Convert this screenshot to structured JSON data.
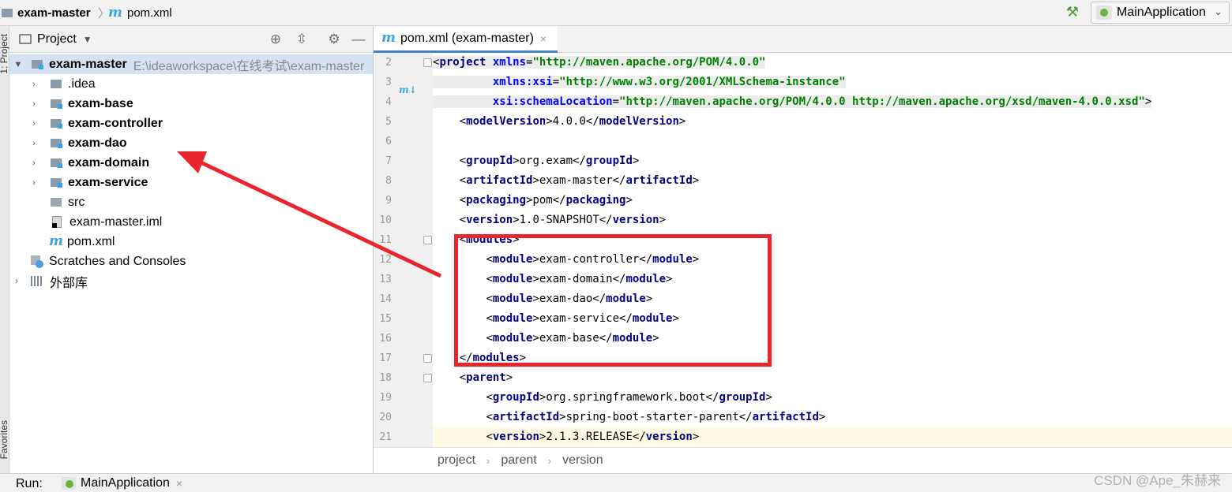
{
  "nav": {
    "project": "exam-master",
    "separator": "〉",
    "file": "pom.xml",
    "run_config": "MainApplication"
  },
  "left_strip": {
    "top_label": "1: Project",
    "bottom_label": "Favorites"
  },
  "project_panel": {
    "title": "Project",
    "root": {
      "name": "exam-master",
      "path": "E:\\ideaworkspace\\在线考试\\exam-master"
    },
    "children": [
      {
        "name": ".idea",
        "bold": false,
        "expandable": true
      },
      {
        "name": "exam-base",
        "bold": true,
        "expandable": true
      },
      {
        "name": "exam-controller",
        "bold": true,
        "expandable": true
      },
      {
        "name": "exam-dao",
        "bold": true,
        "expandable": true
      },
      {
        "name": "exam-domain",
        "bold": true,
        "expandable": true
      },
      {
        "name": "exam-service",
        "bold": true,
        "expandable": true
      },
      {
        "name": "src",
        "bold": false,
        "expandable": false
      },
      {
        "name": "exam-master.iml",
        "bold": false,
        "expandable": false
      },
      {
        "name": "pom.xml",
        "bold": false,
        "expandable": false
      }
    ],
    "scratches": "Scratches and Consoles",
    "external": "外部库"
  },
  "editor": {
    "tab": "pom.xml (exam-master)",
    "lines": [
      {
        "n": "2",
        "html": "<span class='p'>&lt;</span><span class='t'>project </span><span class='a'>xmlns</span><span class='p'>=</span><span class='s'>\"http://maven.apache.org/POM/4.0.0\"</span>",
        "hl": true
      },
      {
        "n": "3",
        "html": "         <span class='a'>xmlns:xsi</span><span class='p'>=</span><span class='s'>\"http://www.w3.org/2001/XMLSchema-instance\"</span>",
        "hl": true
      },
      {
        "n": "4",
        "html": "         <span class='a'>xsi:schemaLocation</span><span class='p'>=</span><span class='s'>\"http://maven.apache.org/POM/4.0.0 http://maven.apache.org/xsd/maven-4.0.0.xsd\"</span><span class='p'>&gt;</span>",
        "hl": true
      },
      {
        "n": "5",
        "html": "    <span class='p'>&lt;</span><span class='t'>modelVersion</span><span class='p'>&gt;4.0.0&lt;/</span><span class='t'>modelVersion</span><span class='p'>&gt;</span>"
      },
      {
        "n": "6",
        "html": ""
      },
      {
        "n": "7",
        "html": "    <span class='p'>&lt;</span><span class='t'>groupId</span><span class='p'>&gt;org.exam&lt;/</span><span class='t'>groupId</span><span class='p'>&gt;</span>"
      },
      {
        "n": "8",
        "html": "    <span class='p'>&lt;</span><span class='t'>artifactId</span><span class='p'>&gt;exam-master&lt;/</span><span class='t'>artifactId</span><span class='p'>&gt;</span>"
      },
      {
        "n": "9",
        "html": "    <span class='p'>&lt;</span><span class='t'>packaging</span><span class='p'>&gt;pom&lt;/</span><span class='t'>packaging</span><span class='p'>&gt;</span>"
      },
      {
        "n": "10",
        "html": "    <span class='p'>&lt;</span><span class='t'>version</span><span class='p'>&gt;1.0-SNAPSHOT&lt;/</span><span class='t'>version</span><span class='p'>&gt;</span>"
      },
      {
        "n": "11",
        "html": "    <span class='p'>&lt;</span><span class='t'>modules</span><span class='p'>&gt;</span>"
      },
      {
        "n": "12",
        "html": "        <span class='p'>&lt;</span><span class='t'>module</span><span class='p'>&gt;exam-controller&lt;/</span><span class='t'>module</span><span class='p'>&gt;</span>"
      },
      {
        "n": "13",
        "html": "        <span class='p'>&lt;</span><span class='t'>module</span><span class='p'>&gt;exam-domain&lt;/</span><span class='t'>module</span><span class='p'>&gt;</span>"
      },
      {
        "n": "14",
        "html": "        <span class='p'>&lt;</span><span class='t'>module</span><span class='p'>&gt;exam-dao&lt;/</span><span class='t'>module</span><span class='p'>&gt;</span>"
      },
      {
        "n": "15",
        "html": "        <span class='p'>&lt;</span><span class='t'>module</span><span class='p'>&gt;exam-service&lt;/</span><span class='t'>module</span><span class='p'>&gt;</span>"
      },
      {
        "n": "16",
        "html": "        <span class='p'>&lt;</span><span class='t'>module</span><span class='p'>&gt;exam-base&lt;/</span><span class='t'>module</span><span class='p'>&gt;</span>"
      },
      {
        "n": "17",
        "html": "    <span class='p'>&lt;/</span><span class='t'>modules</span><span class='p'>&gt;</span>"
      },
      {
        "n": "18",
        "html": "    <span class='p'>&lt;</span><span class='t'>parent</span><span class='p'>&gt;</span>"
      },
      {
        "n": "19",
        "html": "        <span class='p'>&lt;</span><span class='t'>groupId</span><span class='p'>&gt;org.springframework.boot&lt;/</span><span class='t'>groupId</span><span class='p'>&gt;</span>"
      },
      {
        "n": "20",
        "html": "        <span class='p'>&lt;</span><span class='t'>artifactId</span><span class='p'>&gt;spring-boot-starter-parent&lt;/</span><span class='t'>artifactId</span><span class='p'>&gt;</span>"
      },
      {
        "n": "21",
        "html": "        <span class='p'>&lt;</span><span class='t'>version</span><span class='p'>&gt;2.1.3.RELEASE&lt;/</span><span class='t'>version</span><span class='p'>&gt;</span>",
        "current": true
      }
    ],
    "breadcrumbs": [
      "project",
      "parent",
      "version"
    ]
  },
  "bottom": {
    "run_label": "Run:",
    "run_tab": "MainApplication",
    "watermark": "CSDN @Ape_朱赫来"
  },
  "colors": {
    "annotation": "#e8262e",
    "selection": "#d5e2f4",
    "tag": "#000080",
    "string": "#008000"
  }
}
